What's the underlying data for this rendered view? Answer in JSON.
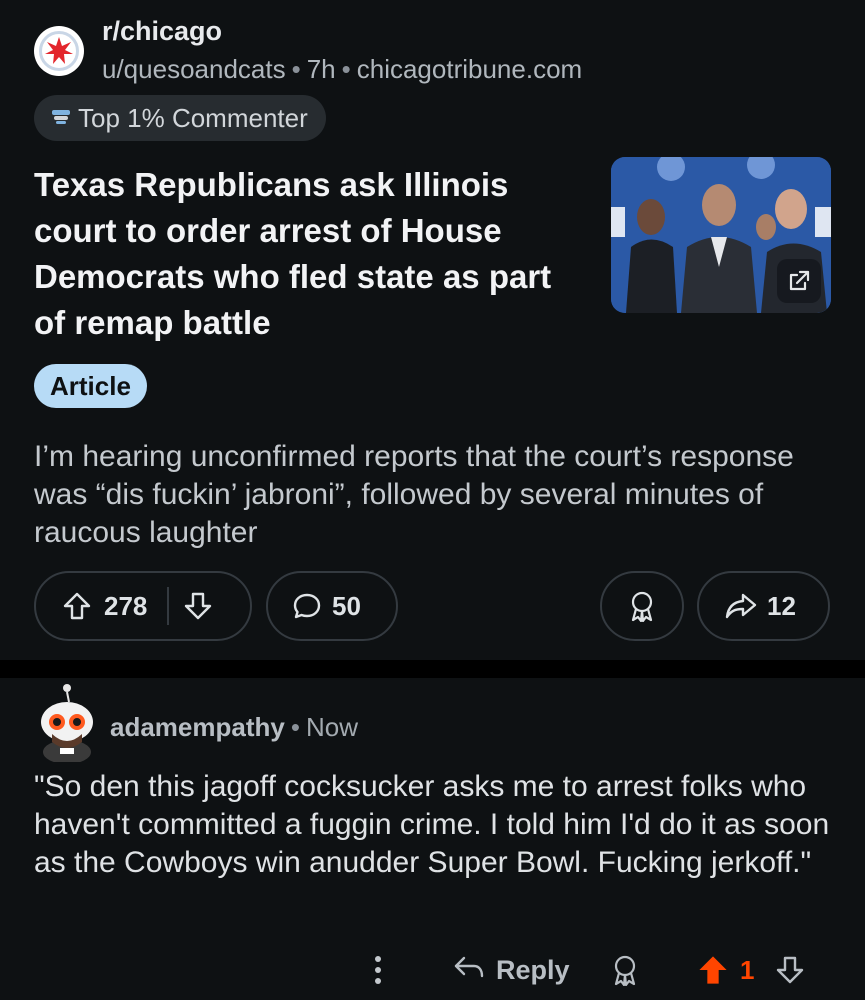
{
  "post": {
    "subreddit": "r/chicago",
    "author": "u/quesoandcats",
    "time": "7h",
    "domain": "chicagotribune.com",
    "flair": "Top 1% Commenter",
    "title": "Texas Republicans ask Illinois court to order arrest of House Democrats who fled state as part of remap battle",
    "tag": "Article",
    "body": "I’m hearing unconfirmed reports that the court’s response was “dis fuckin’ jabroni”, followed by several minutes of raucous laughter",
    "upvotes": "278",
    "comments": "50",
    "shares": "12"
  },
  "comment": {
    "author": "adamempathy",
    "time": "Now",
    "text": "\"So den this jagoff cocksucker asks me to arrest folks who haven't committed a fuggin crime. I told him I'd do it as soon as the Cowboys win anudder Super Bowl. Fucking jerkoff.\"",
    "reply_label": "Reply",
    "votes": "1"
  },
  "colors": {
    "background": "#0e1113",
    "separator": "#000000",
    "tag_bg": "#b7dbf6",
    "upvote_active": "#ff4500",
    "pill_border": "#343a40"
  },
  "icons": {
    "subreddit": "chicago-flag-star-icon",
    "flair": "commenter-badge-icon",
    "upvote": "arrow-up-icon",
    "downvote": "arrow-down-icon",
    "comments": "speech-bubble-icon",
    "award": "award-icon",
    "share": "share-arrow-icon",
    "external": "external-link-icon",
    "more": "more-vertical-icon",
    "reply": "reply-arrow-icon"
  }
}
